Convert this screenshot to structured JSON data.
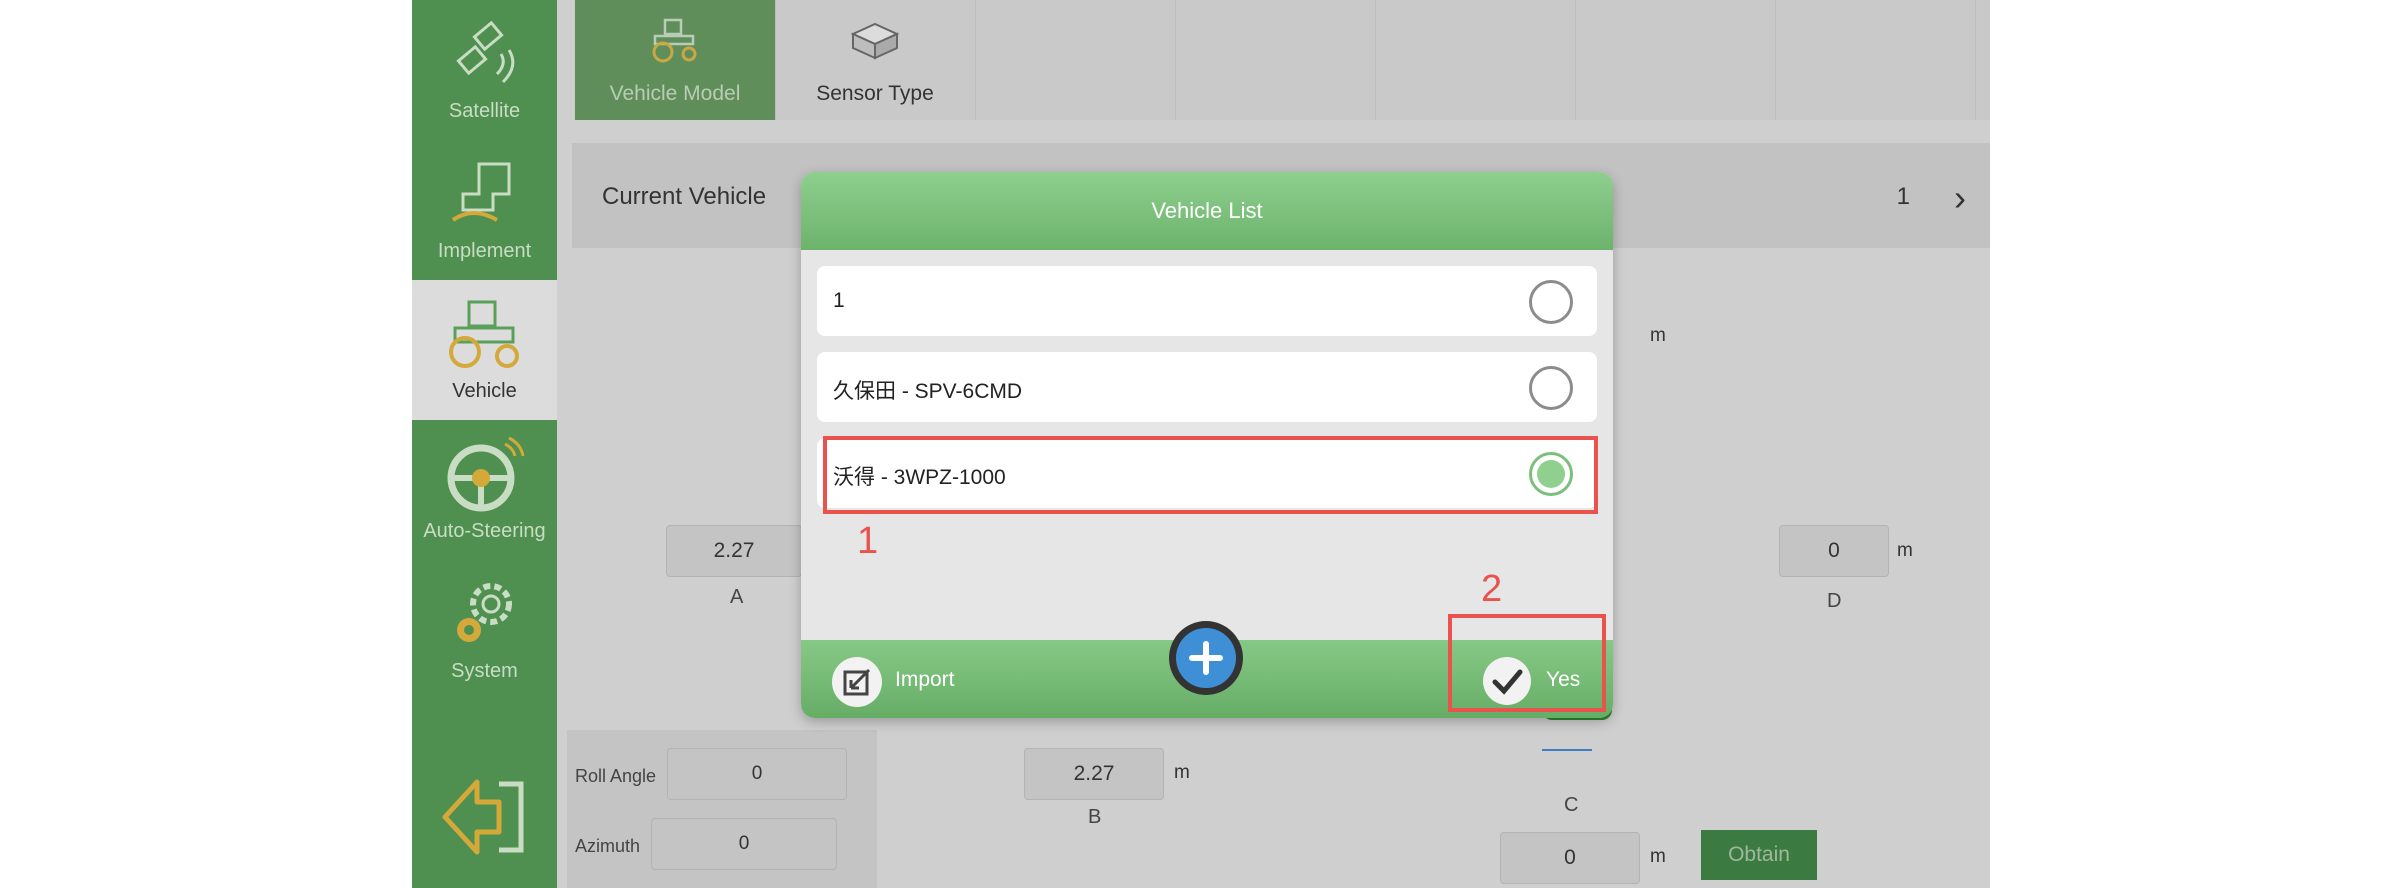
{
  "sidebar": {
    "items": [
      {
        "label": "Satellite",
        "icon": "satellite-icon",
        "active": false
      },
      {
        "label": "Implement",
        "icon": "implement-icon",
        "active": false
      },
      {
        "label": "Vehicle",
        "icon": "tractor-icon",
        "active": true
      },
      {
        "label": "Auto-Steering",
        "icon": "steering-wheel-icon",
        "active": false
      },
      {
        "label": "System",
        "icon": "gear-icon",
        "active": false
      }
    ],
    "exit_icon": "exit-arrow-icon"
  },
  "tabs": [
    {
      "label": "Vehicle Model",
      "icon": "tractor-icon",
      "active": true
    },
    {
      "label": "Sensor Type",
      "icon": "sensor-box-icon",
      "active": false
    }
  ],
  "current_vehicle": {
    "label": "Current Vehicle",
    "value": "1"
  },
  "measurements": {
    "A": {
      "label": "A",
      "value": "2.27"
    },
    "B": {
      "label": "B",
      "value": "2.27",
      "unit": "m"
    },
    "C": {
      "label": "C",
      "value": "0",
      "unit": "m"
    },
    "D": {
      "label": "D",
      "value": "0",
      "unit": "m"
    },
    "top": {
      "unit": "m"
    }
  },
  "sensor_panel": {
    "roll_label": "Roll Angle",
    "roll_value": "0",
    "azimuth_label": "Azimuth",
    "azimuth_value": "0"
  },
  "obtain_label": "Obtain",
  "dialog": {
    "title": "Vehicle List",
    "items": [
      {
        "name": "1",
        "selected": false
      },
      {
        "name": "久保田 - SPV-6CMD",
        "selected": false
      },
      {
        "name": "沃得 - 3WPZ-1000",
        "selected": true
      }
    ],
    "import_label": "Import",
    "yes_label": "Yes"
  },
  "annotations": {
    "step1": "1",
    "step2": "2",
    "color": "#e9524d"
  },
  "colors": {
    "accent_green": "#6cb36c",
    "sidebar_green": "#4f8f4f"
  }
}
